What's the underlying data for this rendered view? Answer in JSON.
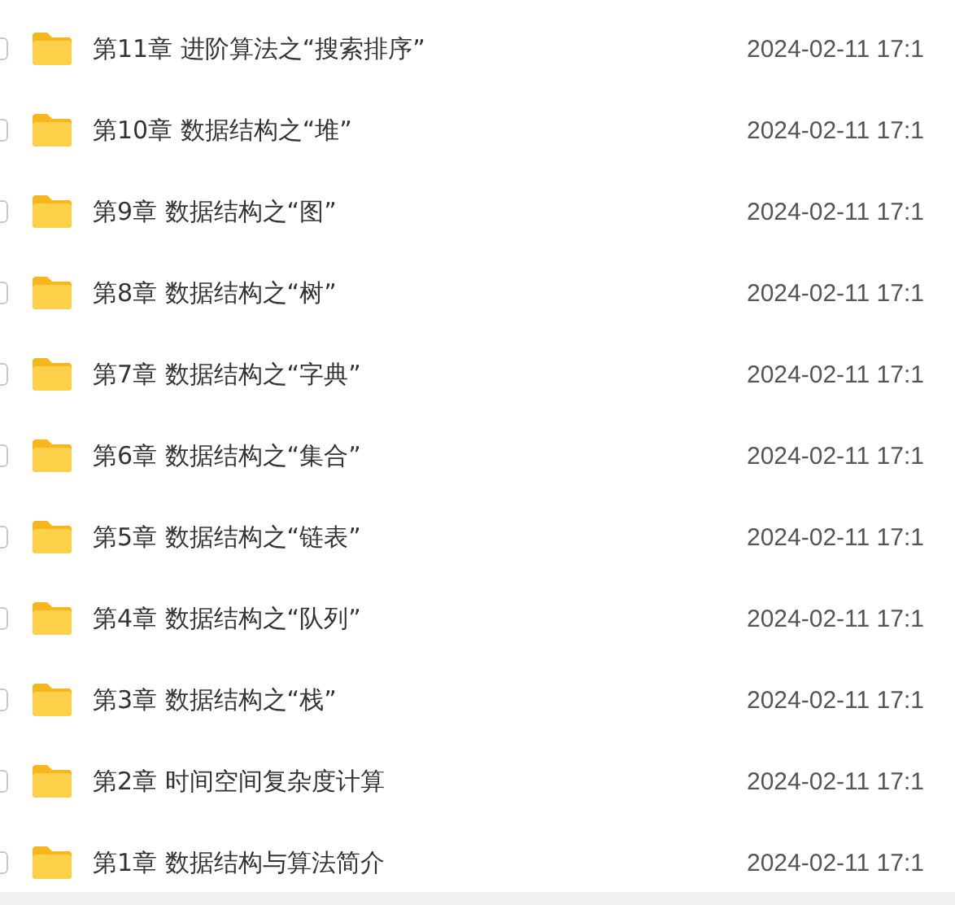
{
  "files": [
    {
      "name": "第11章 进阶算法之“搜索排序”",
      "date": "2024-02-11 17:1",
      "checked": false
    },
    {
      "name": "第10章 数据结构之“堆”",
      "date": "2024-02-11 17:1",
      "checked": false
    },
    {
      "name": "第9章 数据结构之“图”",
      "date": "2024-02-11 17:1",
      "checked": false
    },
    {
      "name": "第8章 数据结构之“树”",
      "date": "2024-02-11 17:1",
      "checked": false
    },
    {
      "name": "第7章 数据结构之“字典”",
      "date": "2024-02-11 17:1",
      "checked": false
    },
    {
      "name": "第6章 数据结构之“集合”",
      "date": "2024-02-11 17:1",
      "checked": false
    },
    {
      "name": "第5章 数据结构之“链表”",
      "date": "2024-02-11 17:1",
      "checked": false
    },
    {
      "name": "第4章 数据结构之“队列”",
      "date": "2024-02-11 17:1",
      "checked": false
    },
    {
      "name": "第3章 数据结构之“栈”",
      "date": "2024-02-11 17:1",
      "checked": false
    },
    {
      "name": "第2章 时间空间复杂度计算",
      "date": "2024-02-11 17:1",
      "checked": false
    },
    {
      "name": "第1章 数据结构与算法简介",
      "date": "2024-02-11 17:1",
      "checked": false
    }
  ]
}
